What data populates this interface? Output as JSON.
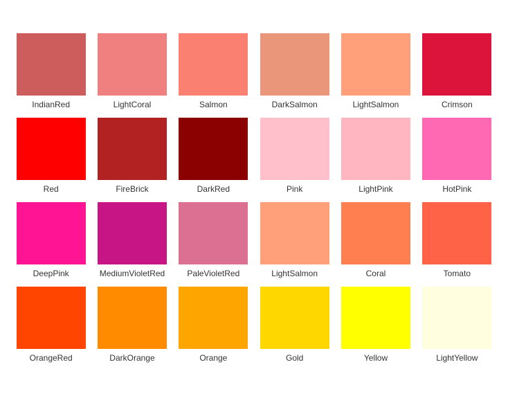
{
  "colors": [
    {
      "name": "IndianRed",
      "hex": "#CD5C5C"
    },
    {
      "name": "LightCoral",
      "hex": "#F08080"
    },
    {
      "name": "Salmon",
      "hex": "#FA8072"
    },
    {
      "name": "DarkSalmon",
      "hex": "#E9967A"
    },
    {
      "name": "LightSalmon",
      "hex": "#FFA07A"
    },
    {
      "name": "Crimson",
      "hex": "#DC143C"
    },
    {
      "name": "Red",
      "hex": "#FF0000"
    },
    {
      "name": "FireBrick",
      "hex": "#B22222"
    },
    {
      "name": "DarkRed",
      "hex": "#8B0000"
    },
    {
      "name": "Pink",
      "hex": "#FFC0CB"
    },
    {
      "name": "LightPink",
      "hex": "#FFB6C1"
    },
    {
      "name": "HotPink",
      "hex": "#FF69B4"
    },
    {
      "name": "DeepPink",
      "hex": "#FF1493"
    },
    {
      "name": "MediumVioletRed",
      "hex": "#C71585"
    },
    {
      "name": "PaleVioletRed",
      "hex": "#DB7093"
    },
    {
      "name": "LightSalmon",
      "hex": "#FFA07A"
    },
    {
      "name": "Coral",
      "hex": "#FF7F50"
    },
    {
      "name": "Tomato",
      "hex": "#FF6347"
    },
    {
      "name": "OrangeRed",
      "hex": "#FF4500"
    },
    {
      "name": "DarkOrange",
      "hex": "#FF8C00"
    },
    {
      "name": "Orange",
      "hex": "#FFA500"
    },
    {
      "name": "Gold",
      "hex": "#FFD700"
    },
    {
      "name": "Yellow",
      "hex": "#FFFF00"
    },
    {
      "name": "LightYellow",
      "hex": "#FFFFE0"
    }
  ]
}
